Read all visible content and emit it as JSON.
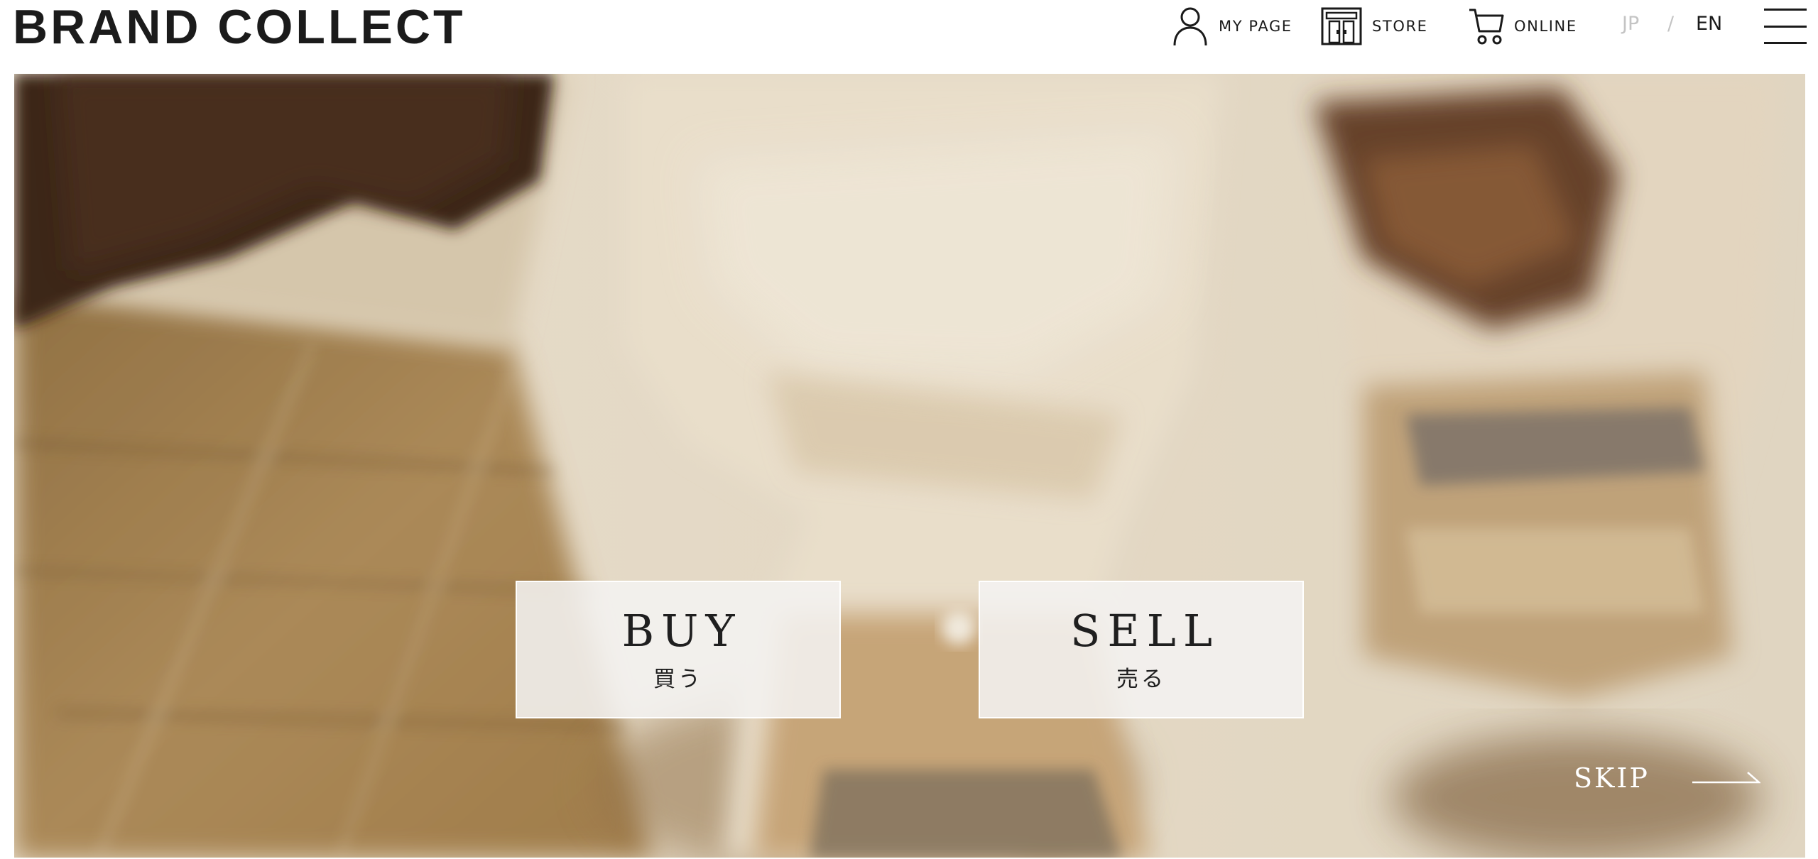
{
  "header": {
    "logo": "BRAND COLLECT",
    "nav": [
      {
        "label": "MY PAGE",
        "icon": "user-icon"
      },
      {
        "label": "STORE",
        "icon": "store-icon"
      },
      {
        "label": "ONLINE",
        "icon": "cart-icon"
      }
    ],
    "lang": {
      "jp": "JP",
      "separator": "/",
      "en": "EN",
      "active": "EN"
    },
    "menu_icon": "hamburger-menu-icon"
  },
  "hero": {
    "buy": {
      "en": "BUY",
      "jp": "買う"
    },
    "sell": {
      "en": "SELL",
      "jp": "売る"
    },
    "skip": {
      "label": "SKIP",
      "icon": "arrow-right-icon"
    }
  },
  "colors": {
    "text": "#1a1a1a",
    "inactive_lang": "#c4c4c4",
    "button_bg": "#f4f3f1",
    "skip_text": "#ffffff"
  }
}
